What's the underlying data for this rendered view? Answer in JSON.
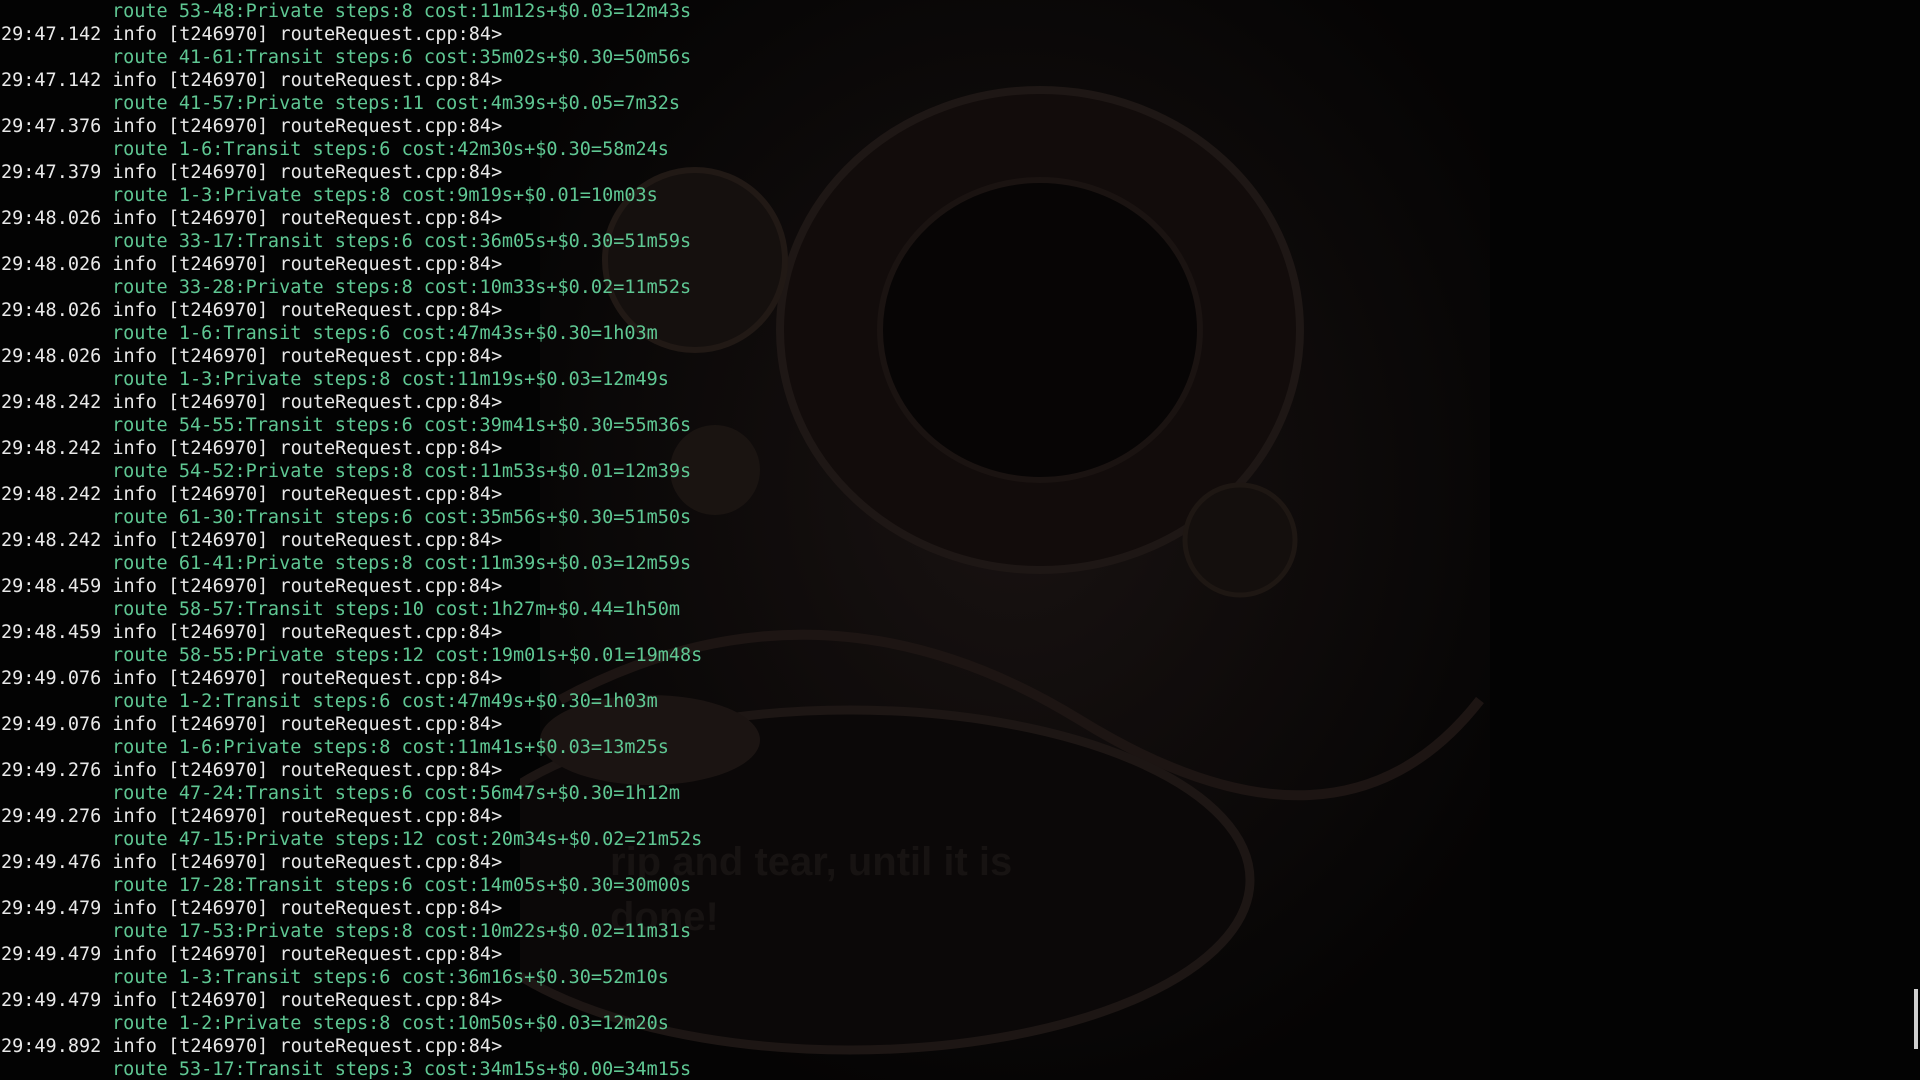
{
  "window": {
    "type": "terminal",
    "background_color": "#030303",
    "text_color": "#e9e9e9",
    "route_text_color": "#5fc793"
  },
  "wallpaper": {
    "caption_line1": "rip and tear, until it is",
    "caption_line2": "done!"
  },
  "scrollbar": {
    "position_fraction": 0.97
  },
  "log": [
    {
      "kind": "route",
      "text": "route 53-48:Private steps:8 cost:11m12s+$0.03=12m43s"
    },
    {
      "kind": "entry",
      "text": "29:47.142 info [t246970] routeRequest.cpp:84>"
    },
    {
      "kind": "route",
      "text": "route 41-61:Transit steps:6 cost:35m02s+$0.30=50m56s"
    },
    {
      "kind": "entry",
      "text": "29:47.142 info [t246970] routeRequest.cpp:84>"
    },
    {
      "kind": "route",
      "text": "route 41-57:Private steps:11 cost:4m39s+$0.05=7m32s"
    },
    {
      "kind": "entry",
      "text": "29:47.376 info [t246970] routeRequest.cpp:84>"
    },
    {
      "kind": "route",
      "text": "route 1-6:Transit steps:6 cost:42m30s+$0.30=58m24s"
    },
    {
      "kind": "entry",
      "text": "29:47.379 info [t246970] routeRequest.cpp:84>"
    },
    {
      "kind": "route",
      "text": "route 1-3:Private steps:8 cost:9m19s+$0.01=10m03s"
    },
    {
      "kind": "entry",
      "text": "29:48.026 info [t246970] routeRequest.cpp:84>"
    },
    {
      "kind": "route",
      "text": "route 33-17:Transit steps:6 cost:36m05s+$0.30=51m59s"
    },
    {
      "kind": "entry",
      "text": "29:48.026 info [t246970] routeRequest.cpp:84>"
    },
    {
      "kind": "route",
      "text": "route 33-28:Private steps:8 cost:10m33s+$0.02=11m52s"
    },
    {
      "kind": "entry",
      "text": "29:48.026 info [t246970] routeRequest.cpp:84>"
    },
    {
      "kind": "route",
      "text": "route 1-6:Transit steps:6 cost:47m43s+$0.30=1h03m"
    },
    {
      "kind": "entry",
      "text": "29:48.026 info [t246970] routeRequest.cpp:84>"
    },
    {
      "kind": "route",
      "text": "route 1-3:Private steps:8 cost:11m19s+$0.03=12m49s"
    },
    {
      "kind": "entry",
      "text": "29:48.242 info [t246970] routeRequest.cpp:84>"
    },
    {
      "kind": "route",
      "text": "route 54-55:Transit steps:6 cost:39m41s+$0.30=55m36s"
    },
    {
      "kind": "entry",
      "text": "29:48.242 info [t246970] routeRequest.cpp:84>"
    },
    {
      "kind": "route",
      "text": "route 54-52:Private steps:8 cost:11m53s+$0.01=12m39s"
    },
    {
      "kind": "entry",
      "text": "29:48.242 info [t246970] routeRequest.cpp:84>"
    },
    {
      "kind": "route",
      "text": "route 61-30:Transit steps:6 cost:35m56s+$0.30=51m50s"
    },
    {
      "kind": "entry",
      "text": "29:48.242 info [t246970] routeRequest.cpp:84>"
    },
    {
      "kind": "route",
      "text": "route 61-41:Private steps:8 cost:11m39s+$0.03=12m59s"
    },
    {
      "kind": "entry",
      "text": "29:48.459 info [t246970] routeRequest.cpp:84>"
    },
    {
      "kind": "route",
      "text": "route 58-57:Transit steps:10 cost:1h27m+$0.44=1h50m"
    },
    {
      "kind": "entry",
      "text": "29:48.459 info [t246970] routeRequest.cpp:84>"
    },
    {
      "kind": "route",
      "text": "route 58-55:Private steps:12 cost:19m01s+$0.01=19m48s"
    },
    {
      "kind": "entry",
      "text": "29:49.076 info [t246970] routeRequest.cpp:84>"
    },
    {
      "kind": "route",
      "text": "route 1-2:Transit steps:6 cost:47m49s+$0.30=1h03m"
    },
    {
      "kind": "entry",
      "text": "29:49.076 info [t246970] routeRequest.cpp:84>"
    },
    {
      "kind": "route",
      "text": "route 1-6:Private steps:8 cost:11m41s+$0.03=13m25s"
    },
    {
      "kind": "entry",
      "text": "29:49.276 info [t246970] routeRequest.cpp:84>"
    },
    {
      "kind": "route",
      "text": "route 47-24:Transit steps:6 cost:56m47s+$0.30=1h12m"
    },
    {
      "kind": "entry",
      "text": "29:49.276 info [t246970] routeRequest.cpp:84>"
    },
    {
      "kind": "route",
      "text": "route 47-15:Private steps:12 cost:20m34s+$0.02=21m52s"
    },
    {
      "kind": "entry",
      "text": "29:49.476 info [t246970] routeRequest.cpp:84>"
    },
    {
      "kind": "route",
      "text": "route 17-28:Transit steps:6 cost:14m05s+$0.30=30m00s"
    },
    {
      "kind": "entry",
      "text": "29:49.479 info [t246970] routeRequest.cpp:84>"
    },
    {
      "kind": "route",
      "text": "route 17-53:Private steps:8 cost:10m22s+$0.02=11m31s"
    },
    {
      "kind": "entry",
      "text": "29:49.479 info [t246970] routeRequest.cpp:84>"
    },
    {
      "kind": "route",
      "text": "route 1-3:Transit steps:6 cost:36m16s+$0.30=52m10s"
    },
    {
      "kind": "entry",
      "text": "29:49.479 info [t246970] routeRequest.cpp:84>"
    },
    {
      "kind": "route",
      "text": "route 1-2:Private steps:8 cost:10m50s+$0.03=12m20s"
    },
    {
      "kind": "entry",
      "text": "29:49.892 info [t246970] routeRequest.cpp:84>"
    },
    {
      "kind": "route",
      "text": "route 53-17:Transit steps:3 cost:34m15s+$0.00=34m15s"
    }
  ]
}
